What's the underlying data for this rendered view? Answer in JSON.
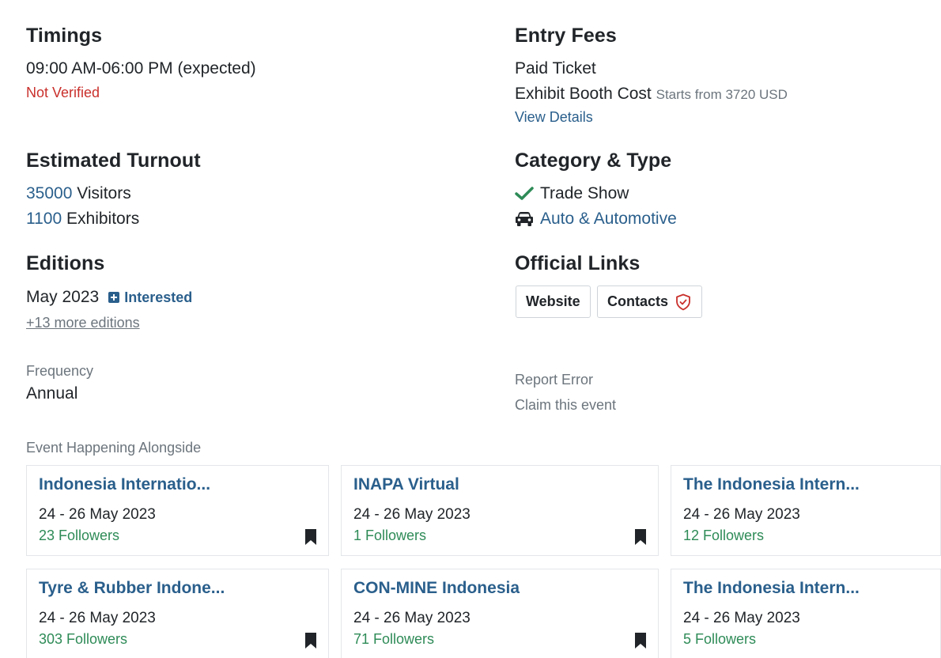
{
  "timings": {
    "heading": "Timings",
    "hours": "09:00 AM-06:00 PM (expected)",
    "status": "Not Verified"
  },
  "entry_fees": {
    "heading": "Entry Fees",
    "ticket": "Paid Ticket",
    "booth_label": "Exhibit Booth Cost",
    "booth_cost": "Starts from 3720 USD",
    "details_link": "View Details"
  },
  "turnout": {
    "heading": "Estimated Turnout",
    "visitors_count": "35000",
    "visitors_label": "Visitors",
    "exhibitors_count": "1100",
    "exhibitors_label": "Exhibitors"
  },
  "category": {
    "heading": "Category & Type",
    "type_label": "Trade Show",
    "type_icon": "check-icon",
    "category_label": "Auto & Automotive",
    "category_icon": "car-icon"
  },
  "editions": {
    "heading": "Editions",
    "current": "May 2023",
    "interested_label": "Interested",
    "more_link": "+13 more editions"
  },
  "official_links": {
    "heading": "Official Links",
    "website_label": "Website",
    "contacts_label": "Contacts",
    "contacts_icon": "shield-check-icon"
  },
  "frequency": {
    "label": "Frequency",
    "value": "Annual"
  },
  "actions": {
    "report": "Report Error",
    "claim": "Claim this event"
  },
  "alongside": {
    "heading": "Event Happening Alongside",
    "cards": [
      {
        "title": "Indonesia Internatio...",
        "date": "24 - 26 May 2023",
        "followers": "23 Followers"
      },
      {
        "title": "INAPA Virtual",
        "date": "24 - 26 May 2023",
        "followers": "1 Followers"
      },
      {
        "title": "The Indonesia Intern...",
        "date": "24 - 26 May 2023",
        "followers": "12 Followers"
      },
      {
        "title": "Tyre & Rubber Indone...",
        "date": "24 - 26 May 2023",
        "followers": "303 Followers"
      },
      {
        "title": "CON-MINE Indonesia",
        "date": "24 - 26 May 2023",
        "followers": "71 Followers"
      },
      {
        "title": "The Indonesia Intern...",
        "date": "24 - 26 May 2023",
        "followers": "5 Followers"
      }
    ]
  },
  "colors": {
    "link": "#2a5f8c",
    "alert": "#c9302c",
    "followers": "#2e8b57",
    "text": "#212529",
    "muted": "#6c757d"
  }
}
